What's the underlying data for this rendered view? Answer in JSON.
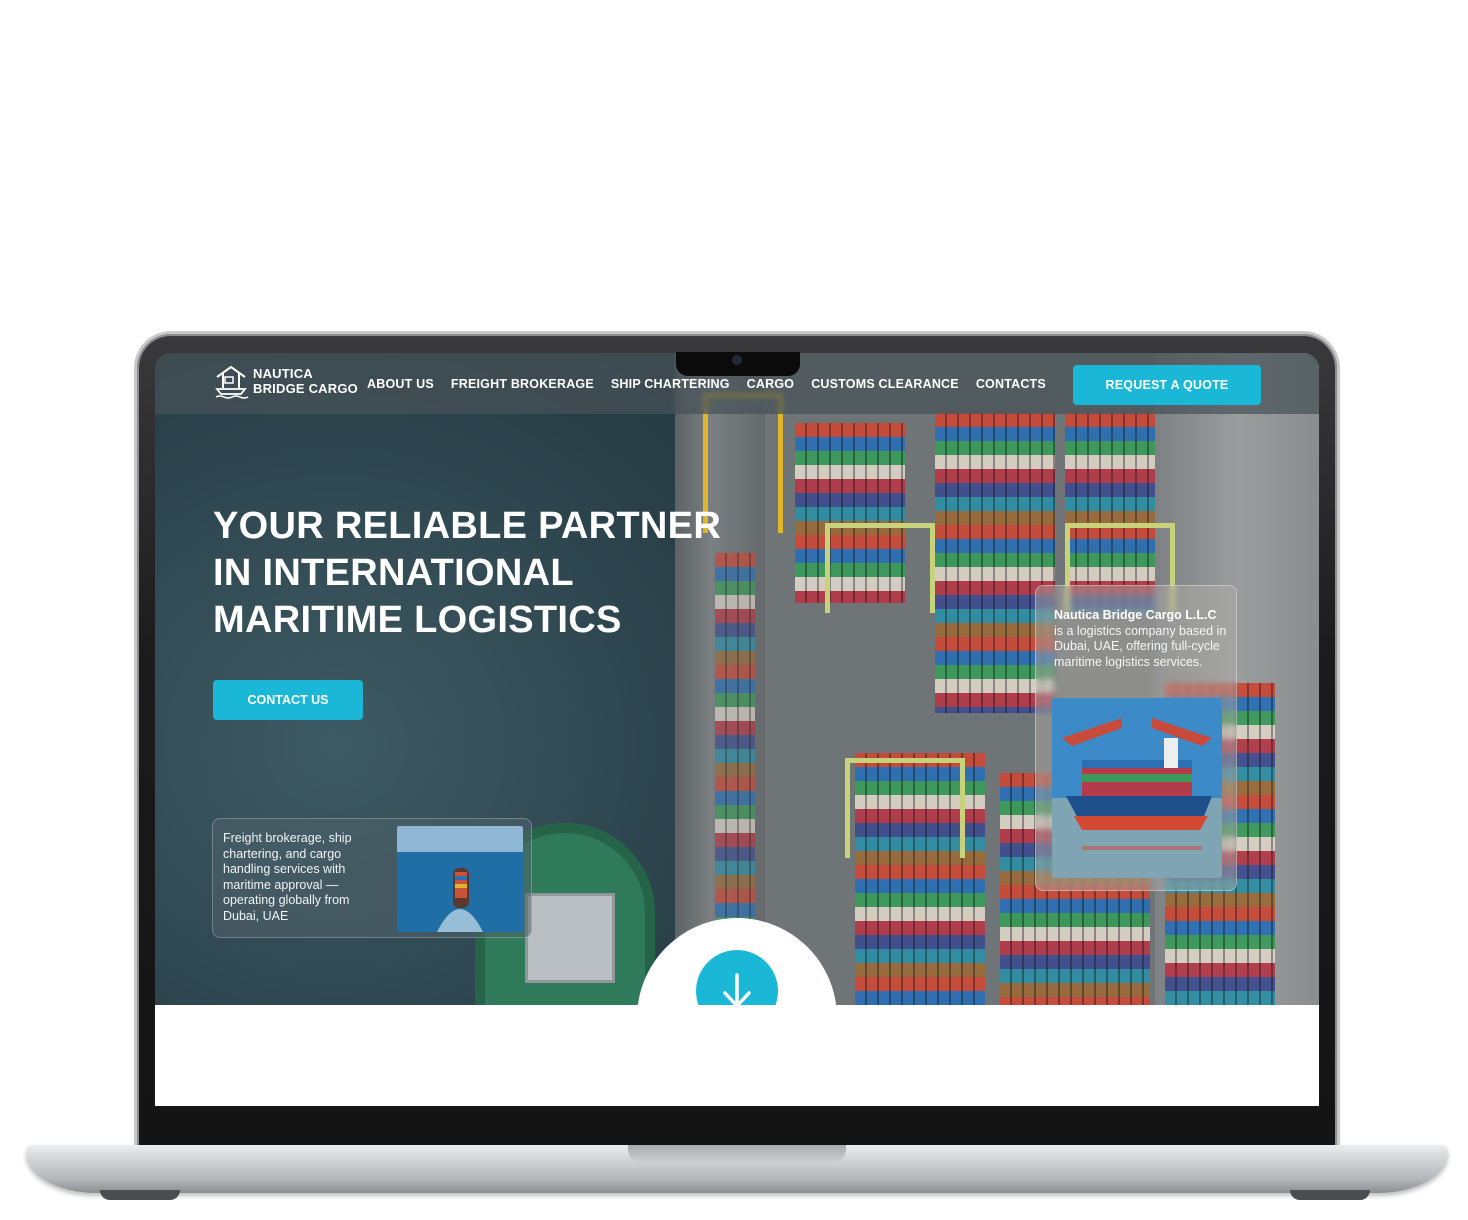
{
  "header": {
    "logo_line1": "NAUTICA",
    "logo_line2": "BRIDGE CARGO",
    "nav": [
      {
        "label": "ABOUT US"
      },
      {
        "label": "FREIGHT BROKERAGE"
      },
      {
        "label": "SHIP CHARTERING"
      },
      {
        "label": "CARGO"
      },
      {
        "label": "CUSTOMS CLEARANCE"
      },
      {
        "label": "CONTACTS"
      }
    ],
    "quote_button": "REQUEST A QUOTE"
  },
  "hero": {
    "title_lines": [
      "YOUR RELIABLE PARTNER",
      "IN INTERNATIONAL",
      "MARITIME LOGISTICS"
    ],
    "contact_button": "CONTACT US",
    "left_card_text": "Freight brokerage, ship chartering, and cargo handling services with maritime approval — operating globally from Dubai, UAE",
    "right_card_title": "Nautica Bridge Cargo L.L.C",
    "right_card_text": "is a logistics company based in Dubai, UAE, offering full-cycle maritime logistics services."
  },
  "icons": {
    "logo": "port-crane-ship-icon",
    "scroll": "arrow-down-icon"
  },
  "colors": {
    "accent": "#1ab8d6",
    "header_bg": "#465258",
    "text_light": "#ffffff"
  }
}
